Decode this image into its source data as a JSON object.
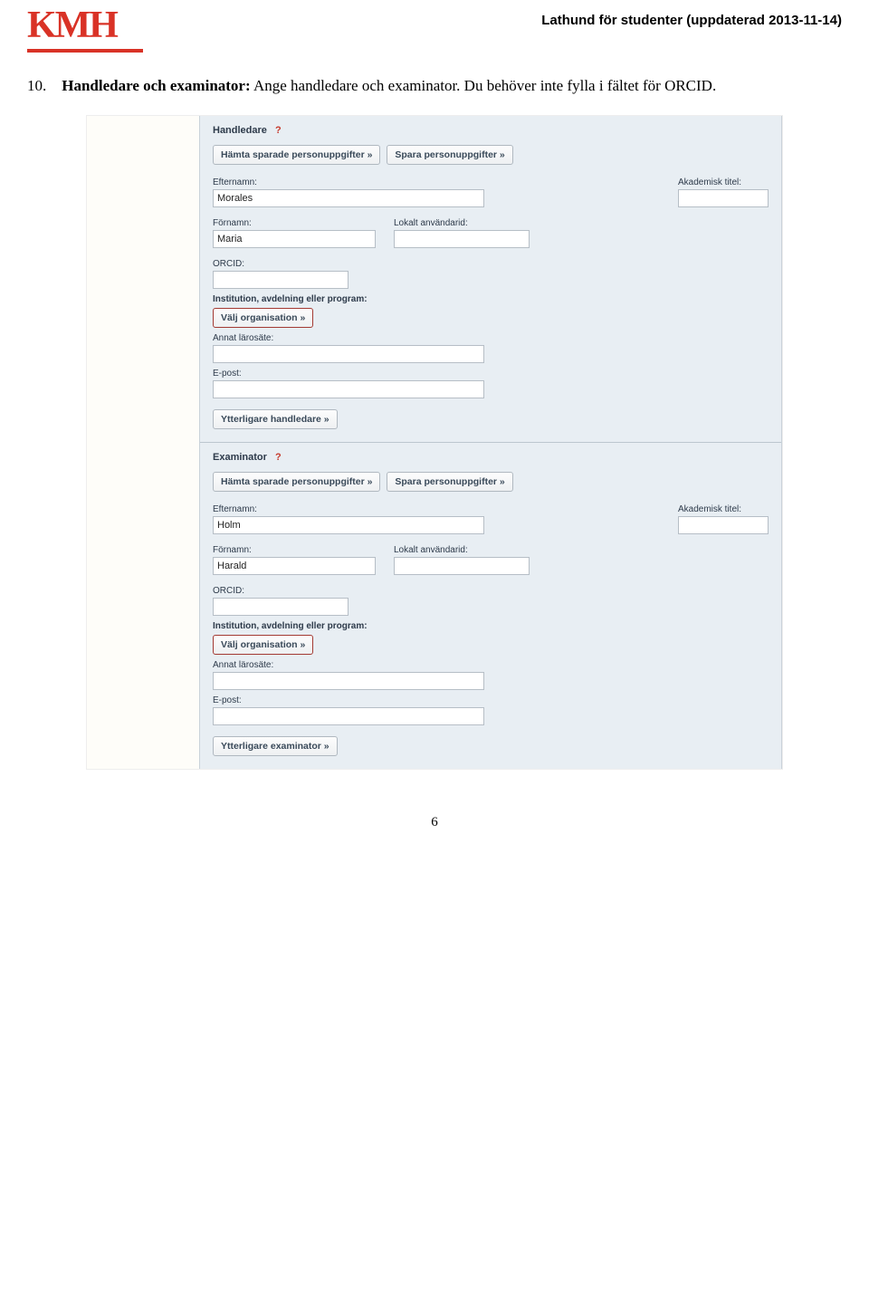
{
  "header": {
    "logo_text": "KMH",
    "right_text": "Lathund för studenter (uppdaterad 2013-11-14)"
  },
  "intro": {
    "number": "10.",
    "title": "Handledare och examinator:",
    "rest": " Ange handledare och examinator. Du behöver inte fylla i fältet för ORCID."
  },
  "buttons": {
    "fetch": "Hämta sparade personuppgifter »",
    "save": "Spara personuppgifter »",
    "pick_org": "Välj organisation »",
    "more_supervisor": "Ytterligare handledare »",
    "more_examiner": "Ytterligare examinator »"
  },
  "labels": {
    "efternamn": "Efternamn:",
    "fornamn": "Förnamn:",
    "akademisk_titel": "Akademisk titel:",
    "lokalt_id": "Lokalt användarid:",
    "orcid": "ORCID:",
    "institution": "Institution, avdelning eller program:",
    "annat_larosate": "Annat lärosäte:",
    "epost": "E-post:"
  },
  "sections": {
    "handledare": {
      "title": "Handledare",
      "help": "?",
      "efternamn": "Morales",
      "fornamn": "Maria",
      "orcid": "",
      "akademisk_titel": "",
      "lokalt_id": "",
      "annat": "",
      "epost": ""
    },
    "examinator": {
      "title": "Examinator",
      "help": "?",
      "efternamn": "Holm",
      "fornamn": "Harald",
      "orcid": "",
      "akademisk_titel": "",
      "lokalt_id": "",
      "annat": "",
      "epost": ""
    }
  },
  "page_number": "6"
}
